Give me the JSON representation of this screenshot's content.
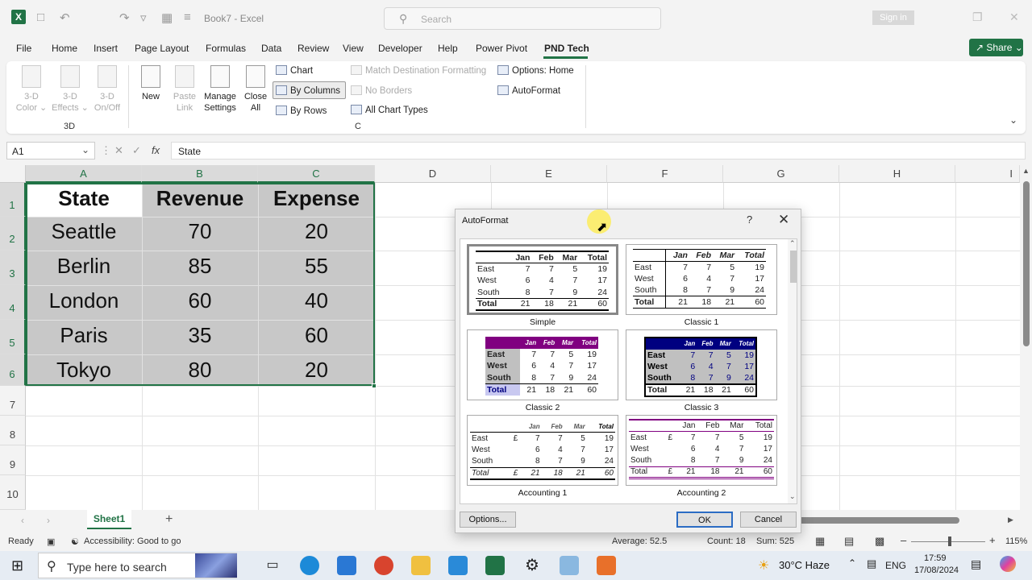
{
  "app": {
    "title": "Book7  -  Excel",
    "search_placeholder": "Search",
    "signin": "Sign in"
  },
  "tabs": [
    "File",
    "Home",
    "Insert",
    "Page Layout",
    "Formulas",
    "Data",
    "Review",
    "View",
    "Developer",
    "Help",
    "Power Pivot",
    "PND Tech"
  ],
  "share": "Share",
  "ribbon": {
    "btn_3d_color": "3-D Color ⌄",
    "btn_3d_effects": "3-D Effects ⌄",
    "btn_3d_onoff": "3-D On/Off",
    "group_3d": "3D",
    "btn_new": "New",
    "btn_paste_link": "Paste Link",
    "btn_manage": "Manage Settings",
    "btn_close_all": "Close All",
    "chart": "Chart",
    "by_columns": "By Columns",
    "by_rows": "By Rows",
    "match_dest": "Match Destination Formatting",
    "no_borders": "No Borders",
    "all_chart_types": "All Chart Types",
    "options_home": "Options: Home",
    "autoformat": "AutoFormat",
    "group_c": "C"
  },
  "formula_bar": {
    "name_box": "A1",
    "fx": "fx",
    "content": "State"
  },
  "columns": [
    "A",
    "B",
    "C",
    "D",
    "E",
    "F",
    "G",
    "H",
    "I"
  ],
  "rows": [
    "1",
    "2",
    "3",
    "4",
    "5",
    "6",
    "7",
    "8",
    "9",
    "10"
  ],
  "sheet": {
    "header": [
      "State",
      "Revenue",
      "Expense"
    ],
    "data": [
      [
        "Seattle",
        "70",
        "20"
      ],
      [
        "Berlin",
        "85",
        "55"
      ],
      [
        "London",
        "60",
        "40"
      ],
      [
        "Paris",
        "35",
        "60"
      ],
      [
        "Tokyo",
        "80",
        "20"
      ]
    ]
  },
  "sheet_tab": "Sheet1",
  "status": {
    "ready": "Ready",
    "accessibility": "Accessibility: Good to go",
    "average": "Average: 52.5",
    "count": "Count: 18",
    "sum": "Sum: 525",
    "zoom": "115%"
  },
  "dialog": {
    "title": "AutoFormat",
    "help": "?",
    "close": "✕",
    "options_btn": "Options...",
    "ok_btn": "OK",
    "cancel_btn": "Cancel",
    "formats": [
      {
        "name": "Simple"
      },
      {
        "name": "Classic 1"
      },
      {
        "name": "Classic 2"
      },
      {
        "name": "Classic 3"
      },
      {
        "name": "Accounting 1"
      },
      {
        "name": "Accounting 2"
      }
    ],
    "preview": {
      "header": [
        "",
        "Jan",
        "Feb",
        "Mar",
        "Total"
      ],
      "rows": [
        [
          "East",
          "7",
          "7",
          "5",
          "19"
        ],
        [
          "West",
          "6",
          "4",
          "7",
          "17"
        ],
        [
          "South",
          "8",
          "7",
          "9",
          "24"
        ],
        [
          "Total",
          "21",
          "18",
          "21",
          "60"
        ]
      ],
      "currency": "£"
    }
  },
  "taskbar": {
    "search_placeholder": "Type here to search",
    "weather": "30°C  Haze",
    "lang": "ENG",
    "time": "17:59",
    "date": "17/08/2024"
  }
}
